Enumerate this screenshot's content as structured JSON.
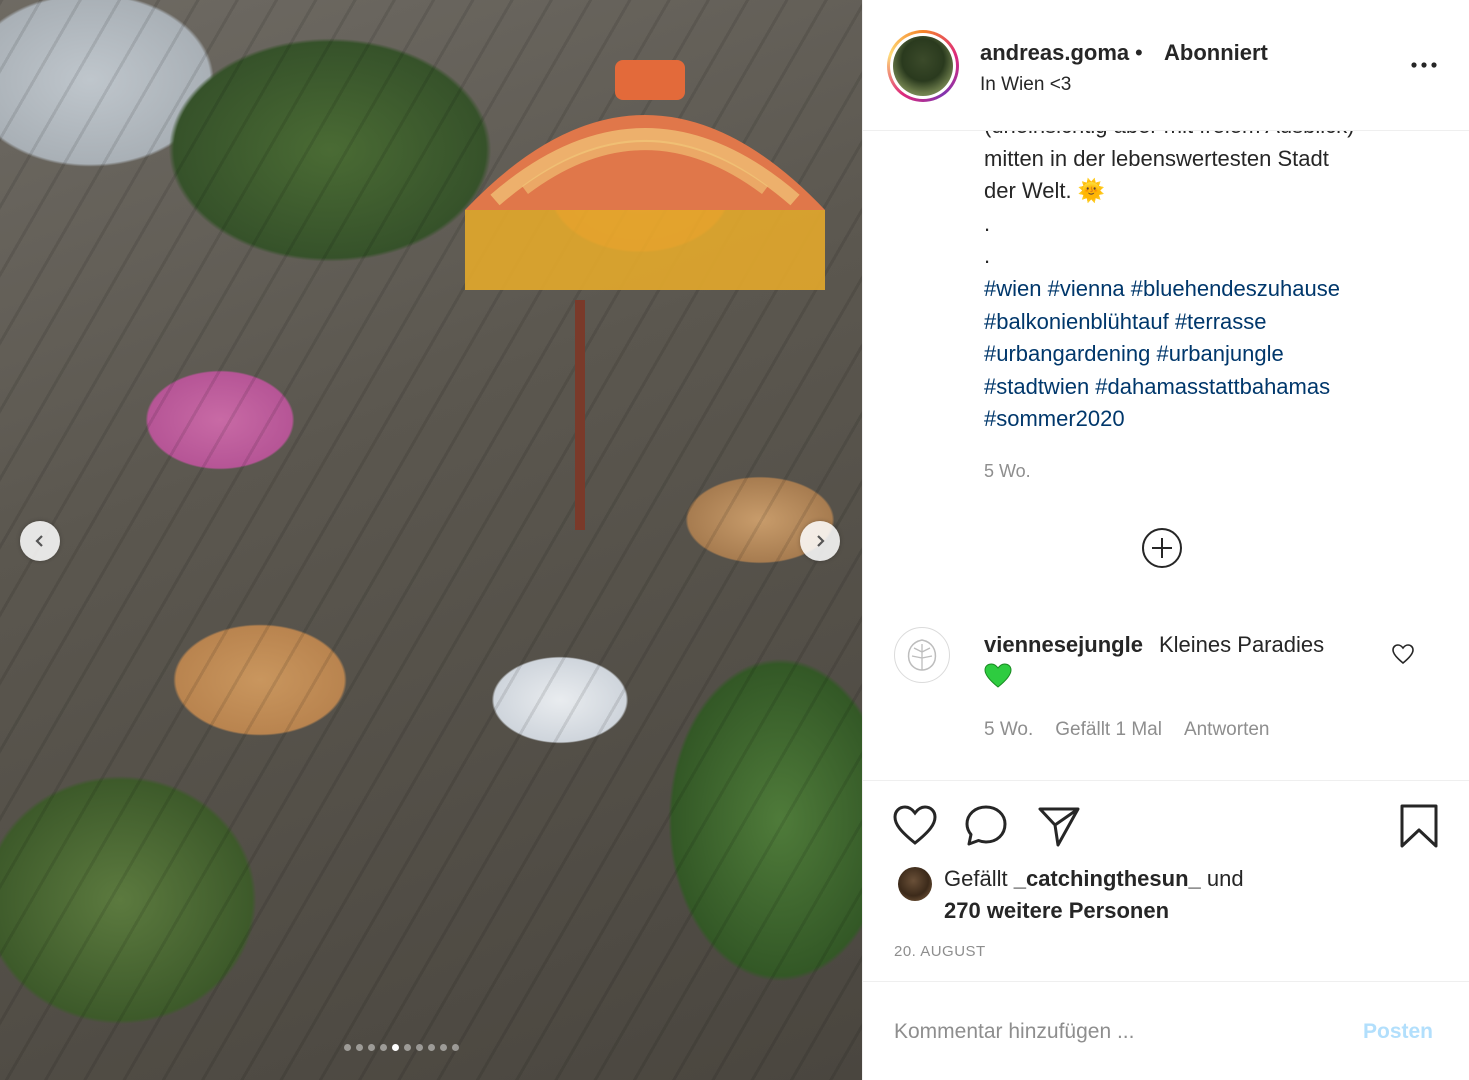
{
  "post": {
    "username": "andreas.goma",
    "separator": "•",
    "follow_status": "Abonniert",
    "location": "In Wien <3",
    "caption_clipped": "(uneinsichtig aber mit freiem Ausblick)",
    "caption_line1": "mitten in der lebenswertesten Stadt",
    "caption_line2": "der Welt. 🌞",
    "caption_dot1": ".",
    "caption_dot2": ".",
    "hashtags": [
      "#wien #vienna #bluehendeszuhause",
      "#balkonienblühtauf #terrasse",
      "#urbangardening #urbanjungle",
      "#stadtwien #dahamasstattbahamas",
      "#sommer2020"
    ],
    "time_ago": "5 Wo."
  },
  "comment": {
    "username": "viennesejungle",
    "text": "Kleines Paradies",
    "emoji": "💚",
    "time_ago": "5 Wo.",
    "likes": "Gefällt 1 Mal",
    "reply": "Antworten"
  },
  "likes": {
    "prefix": "Gefällt",
    "user": "_catchingthesun_",
    "conjunction": "und",
    "others": "270 weitere Personen"
  },
  "date": "20. AUGUST",
  "comment_input": {
    "placeholder": "Kommentar hinzufügen ...",
    "post_label": "Posten"
  },
  "carousel": {
    "total": 10,
    "active_index": 4
  },
  "icons": {
    "more": "more-horizontal-icon",
    "load_more": "plus-circle-icon",
    "like": "heart-icon",
    "comment": "comment-bubble-icon",
    "share": "paper-plane-icon",
    "save": "bookmark-icon"
  },
  "colors": {
    "text": "#262626",
    "muted": "#8e8e8e",
    "hashtag": "#00376b",
    "post_button": "#b2dffc",
    "heart_emoji": "#2ecc40"
  }
}
